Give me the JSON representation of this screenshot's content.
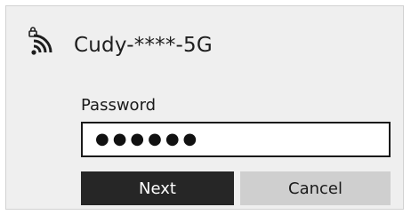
{
  "network": {
    "name": "Cudy-****-5G",
    "icon": "wifi-secured-icon"
  },
  "password": {
    "label": "Password",
    "value_masked": "●●●●●●"
  },
  "buttons": {
    "next_label": "Next",
    "cancel_label": "Cancel"
  },
  "colors": {
    "panel_bg": "#efefef",
    "next_bg": "#262626",
    "cancel_bg": "#cfcfcf",
    "field_border": "#1a1a1a"
  }
}
